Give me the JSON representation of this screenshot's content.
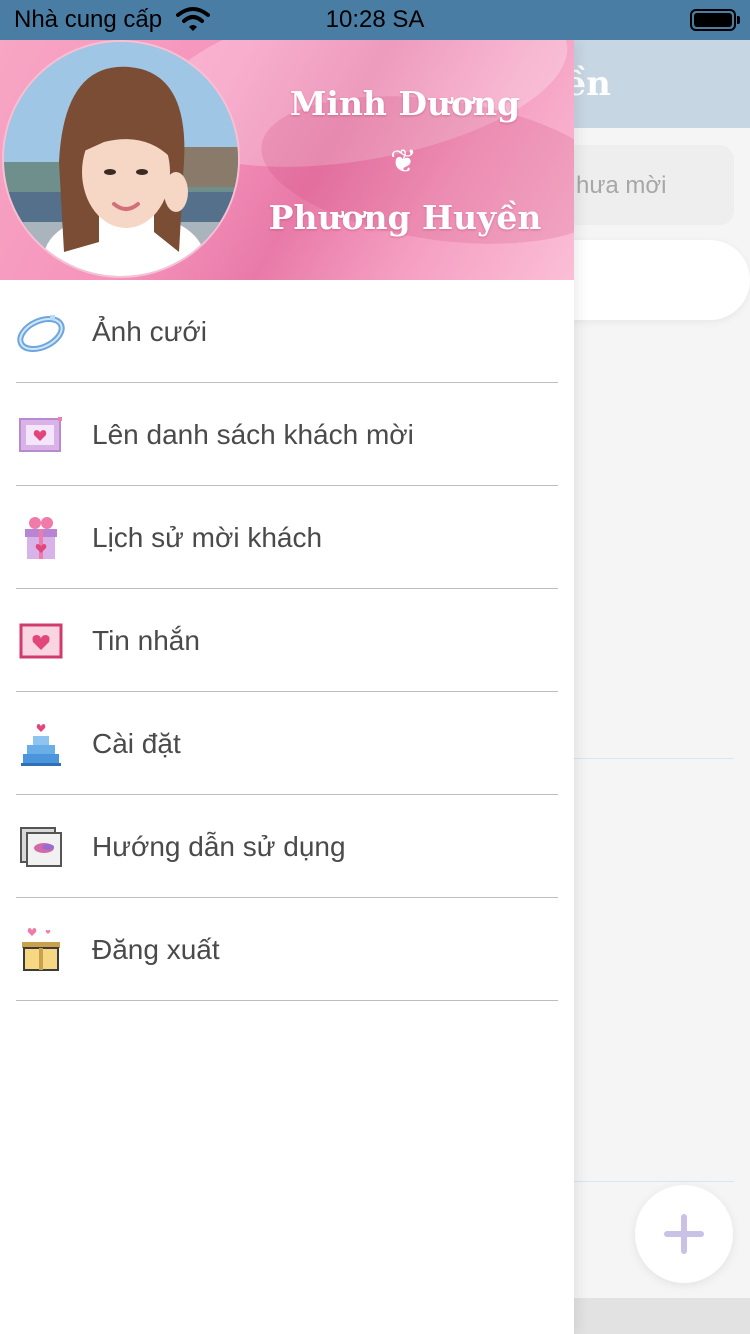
{
  "status_bar": {
    "carrier": "Nhà cung cấp",
    "time": "10:28 SA"
  },
  "background": {
    "title_fragment": "uyền",
    "search_placeholder_fragment": "hưa mời",
    "colors": {
      "header": "#c7d6e3",
      "fab_plus": "#c9c2e6"
    }
  },
  "drawer": {
    "header": {
      "name_one": "Minh Dương",
      "separator": "❦",
      "name_two": "Phương Huyền"
    },
    "colors": {
      "header_pink": "#f694bd",
      "text": "#4a4a4a",
      "divider": "#bdbdbd"
    },
    "menu": [
      {
        "label": "Ảnh cưới",
        "icon": "ring-icon"
      },
      {
        "label": "Lên danh sách khách mời",
        "icon": "envelope-heart-icon"
      },
      {
        "label": "Lịch sử mời khách",
        "icon": "gift-box-icon"
      },
      {
        "label": "Tin nhắn",
        "icon": "message-heart-icon"
      },
      {
        "label": "Cài đặt",
        "icon": "wedding-cake-icon"
      },
      {
        "label": "Hướng dẫn sử dụng",
        "icon": "photo-frame-icon"
      },
      {
        "label": "Đăng xuất",
        "icon": "open-box-icon"
      }
    ]
  }
}
